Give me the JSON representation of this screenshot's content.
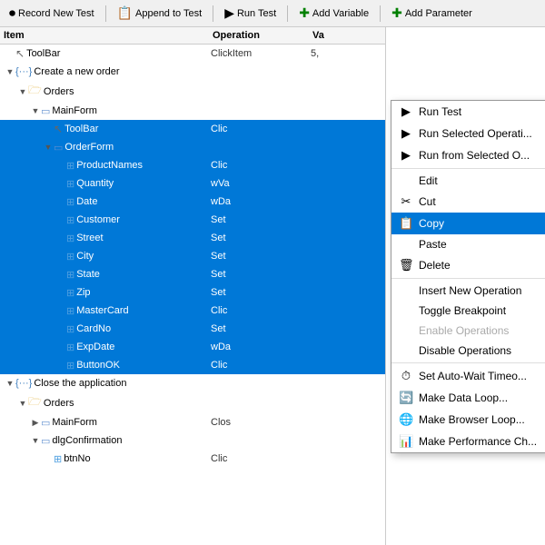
{
  "toolbar": {
    "buttons": [
      {
        "label": "Record New Test",
        "icon": "⏺",
        "name": "record-new-test-btn"
      },
      {
        "label": "Append to Test",
        "icon": "📋",
        "name": "append-to-test-btn"
      },
      {
        "label": "Run Test",
        "icon": "▶",
        "name": "run-test-btn"
      },
      {
        "label": "Add Variable",
        "icon": "✚",
        "name": "add-variable-btn"
      },
      {
        "label": "Add Parameter",
        "icon": "✚",
        "name": "add-parameter-btn"
      }
    ]
  },
  "columns": {
    "item": "Item",
    "operation": "Operation",
    "value": "Va"
  },
  "tree": [
    {
      "id": 1,
      "depth": 0,
      "expanded": true,
      "icon": "cursor",
      "label": "ToolBar",
      "op": "ClickItem",
      "val": "5,",
      "selected": false
    },
    {
      "id": 2,
      "depth": 0,
      "expanded": true,
      "icon": "group",
      "label": "Create a new order",
      "op": "",
      "val": "",
      "selected": false
    },
    {
      "id": 3,
      "depth": 1,
      "expanded": true,
      "icon": "folder",
      "label": "Orders",
      "op": "",
      "val": "",
      "selected": false
    },
    {
      "id": 4,
      "depth": 2,
      "expanded": true,
      "icon": "form",
      "label": "MainForm",
      "op": "",
      "val": "",
      "selected": false
    },
    {
      "id": 5,
      "depth": 3,
      "expanded": false,
      "icon": "cursor",
      "label": "ToolBar",
      "op": "Clic",
      "val": "",
      "selected": true
    },
    {
      "id": 6,
      "depth": 3,
      "expanded": true,
      "icon": "form",
      "label": "OrderForm",
      "op": "",
      "val": "",
      "selected": true
    },
    {
      "id": 7,
      "depth": 4,
      "expanded": false,
      "icon": "field",
      "label": "ProductNames",
      "op": "Clic",
      "val": "",
      "selected": true
    },
    {
      "id": 8,
      "depth": 4,
      "expanded": false,
      "icon": "field",
      "label": "Quantity",
      "op": "wVa",
      "val": "",
      "selected": true
    },
    {
      "id": 9,
      "depth": 4,
      "expanded": false,
      "icon": "field",
      "label": "Date",
      "op": "wDa",
      "val": "",
      "selected": true
    },
    {
      "id": 10,
      "depth": 4,
      "expanded": false,
      "icon": "field",
      "label": "Customer",
      "op": "Set",
      "val": "",
      "selected": true
    },
    {
      "id": 11,
      "depth": 4,
      "expanded": false,
      "icon": "field",
      "label": "Street",
      "op": "Set",
      "val": "",
      "selected": true
    },
    {
      "id": 12,
      "depth": 4,
      "expanded": false,
      "icon": "field",
      "label": "City",
      "op": "Set",
      "val": "",
      "selected": true
    },
    {
      "id": 13,
      "depth": 4,
      "expanded": false,
      "icon": "field",
      "label": "State",
      "op": "Set",
      "val": "",
      "selected": true
    },
    {
      "id": 14,
      "depth": 4,
      "expanded": false,
      "icon": "field",
      "label": "Zip",
      "op": "Set",
      "val": "",
      "selected": true
    },
    {
      "id": 15,
      "depth": 4,
      "expanded": false,
      "icon": "field",
      "label": "MasterCard",
      "op": "Clic",
      "val": "",
      "selected": true
    },
    {
      "id": 16,
      "depth": 4,
      "expanded": false,
      "icon": "field",
      "label": "CardNo",
      "op": "Set",
      "val": "",
      "selected": true
    },
    {
      "id": 17,
      "depth": 4,
      "expanded": false,
      "icon": "field",
      "label": "ExpDate",
      "op": "wDa",
      "val": "",
      "selected": true
    },
    {
      "id": 18,
      "depth": 4,
      "expanded": false,
      "icon": "field",
      "label": "ButtonOK",
      "op": "Clic",
      "val": "",
      "selected": true
    },
    {
      "id": 19,
      "depth": 0,
      "expanded": true,
      "icon": "group",
      "label": "Close the application",
      "op": "",
      "val": "",
      "selected": false
    },
    {
      "id": 20,
      "depth": 1,
      "expanded": true,
      "icon": "folder",
      "label": "Orders",
      "op": "",
      "val": "",
      "selected": false
    },
    {
      "id": 21,
      "depth": 2,
      "expanded": false,
      "icon": "form",
      "label": "MainForm",
      "op": "Clos",
      "val": "",
      "selected": false
    },
    {
      "id": 22,
      "depth": 2,
      "expanded": true,
      "icon": "form",
      "label": "dlgConfirmation",
      "op": "",
      "val": "",
      "selected": false
    },
    {
      "id": 23,
      "depth": 3,
      "expanded": false,
      "icon": "field",
      "label": "btnNo",
      "op": "Clic",
      "val": "",
      "selected": false
    }
  ],
  "context_menu": {
    "items": [
      {
        "label": "Run Test",
        "icon": "▶",
        "type": "item",
        "highlighted": false,
        "disabled": false,
        "name": "ctx-run-test"
      },
      {
        "label": "Run Selected Operati...",
        "icon": "▶",
        "type": "item",
        "highlighted": false,
        "disabled": false,
        "name": "ctx-run-selected-op"
      },
      {
        "label": "Run from Selected O...",
        "icon": "▶",
        "type": "item",
        "highlighted": false,
        "disabled": false,
        "name": "ctx-run-from-selected"
      },
      {
        "type": "separator"
      },
      {
        "label": "Edit",
        "icon": "",
        "type": "item",
        "highlighted": false,
        "disabled": false,
        "name": "ctx-edit"
      },
      {
        "label": "Cut",
        "icon": "✂",
        "type": "item",
        "highlighted": false,
        "disabled": false,
        "name": "ctx-cut"
      },
      {
        "label": "Copy",
        "icon": "📋",
        "type": "item",
        "highlighted": true,
        "disabled": false,
        "name": "ctx-copy"
      },
      {
        "label": "Paste",
        "icon": "",
        "type": "item",
        "highlighted": false,
        "disabled": false,
        "name": "ctx-paste"
      },
      {
        "label": "Delete",
        "icon": "🗑",
        "type": "item",
        "highlighted": false,
        "disabled": false,
        "name": "ctx-delete"
      },
      {
        "type": "separator"
      },
      {
        "label": "Insert New Operation",
        "icon": "",
        "type": "item",
        "highlighted": false,
        "disabled": false,
        "name": "ctx-insert-new-op"
      },
      {
        "label": "Toggle Breakpoint",
        "icon": "",
        "type": "item",
        "highlighted": false,
        "disabled": false,
        "name": "ctx-toggle-breakpoint"
      },
      {
        "label": "Enable Operations",
        "icon": "",
        "type": "item",
        "highlighted": false,
        "disabled": true,
        "name": "ctx-enable-ops"
      },
      {
        "label": "Disable Operations",
        "icon": "",
        "type": "item",
        "highlighted": false,
        "disabled": false,
        "name": "ctx-disable-ops"
      },
      {
        "type": "separator"
      },
      {
        "label": "Set Auto-Wait Timeo...",
        "icon": "⏱",
        "type": "item",
        "highlighted": false,
        "disabled": false,
        "name": "ctx-auto-wait"
      },
      {
        "label": "Make Data Loop...",
        "icon": "🔄",
        "type": "item",
        "highlighted": false,
        "disabled": false,
        "name": "ctx-make-data-loop"
      },
      {
        "label": "Make Browser Loop...",
        "icon": "🌐",
        "type": "item",
        "highlighted": false,
        "disabled": false,
        "name": "ctx-make-browser-loop"
      },
      {
        "label": "Make Performance Ch...",
        "icon": "📊",
        "type": "item",
        "highlighted": false,
        "disabled": false,
        "name": "ctx-make-perf"
      }
    ]
  }
}
